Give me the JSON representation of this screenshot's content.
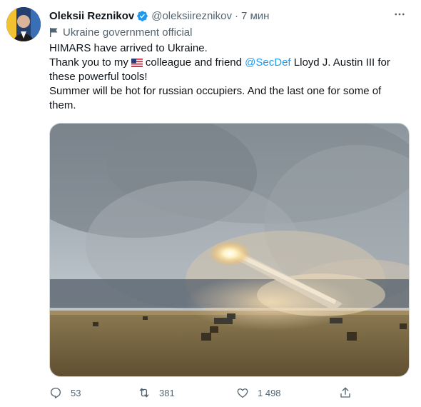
{
  "tweet": {
    "author_name": "Oleksii Reznikov",
    "handle": "@oleksiireznikov",
    "separator": "·",
    "time": "7 мин",
    "label": "Ukraine government official",
    "line1": "HIMARS have arrived to Ukraine.",
    "line2_a": "Thank you to my",
    "line2_b": "colleague and friend",
    "mention": "@SecDef",
    "line2_c": "Lloyd J. Austin III for",
    "line3": "these powerful tools!",
    "line4": "Summer will be hot for russian occupiers. And the last one for some of",
    "line5": "them."
  },
  "actions": {
    "replies": "53",
    "retweets": "381",
    "likes": "1 498"
  },
  "colors": {
    "accent": "#1d9bf0",
    "secondary_text": "#536471",
    "primary_text": "#0f1419"
  },
  "icons": [
    "verified-badge-icon",
    "more-icon",
    "government-flag-icon",
    "us-flag-icon",
    "reply-icon",
    "retweet-icon",
    "like-icon",
    "share-icon"
  ]
}
